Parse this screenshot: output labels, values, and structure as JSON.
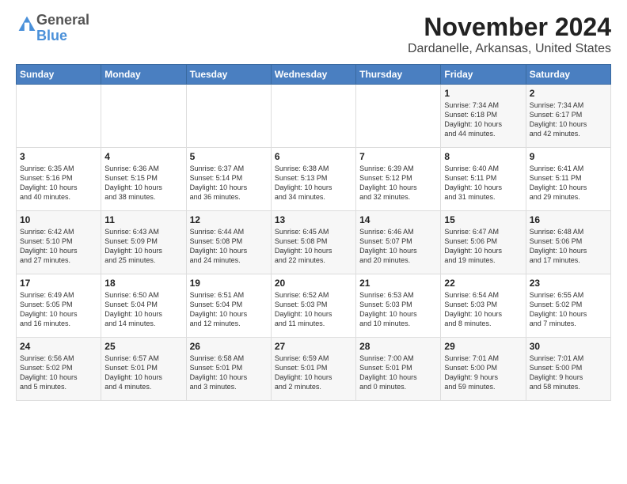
{
  "logo": {
    "general": "General",
    "blue": "Blue"
  },
  "title": "November 2024",
  "location": "Dardanelle, Arkansas, United States",
  "days_header": [
    "Sunday",
    "Monday",
    "Tuesday",
    "Wednesday",
    "Thursday",
    "Friday",
    "Saturday"
  ],
  "weeks": [
    [
      {
        "day": "",
        "info": ""
      },
      {
        "day": "",
        "info": ""
      },
      {
        "day": "",
        "info": ""
      },
      {
        "day": "",
        "info": ""
      },
      {
        "day": "",
        "info": ""
      },
      {
        "day": "1",
        "info": "Sunrise: 7:34 AM\nSunset: 6:18 PM\nDaylight: 10 hours\nand 44 minutes."
      },
      {
        "day": "2",
        "info": "Sunrise: 7:34 AM\nSunset: 6:17 PM\nDaylight: 10 hours\nand 42 minutes."
      }
    ],
    [
      {
        "day": "3",
        "info": "Sunrise: 6:35 AM\nSunset: 5:16 PM\nDaylight: 10 hours\nand 40 minutes."
      },
      {
        "day": "4",
        "info": "Sunrise: 6:36 AM\nSunset: 5:15 PM\nDaylight: 10 hours\nand 38 minutes."
      },
      {
        "day": "5",
        "info": "Sunrise: 6:37 AM\nSunset: 5:14 PM\nDaylight: 10 hours\nand 36 minutes."
      },
      {
        "day": "6",
        "info": "Sunrise: 6:38 AM\nSunset: 5:13 PM\nDaylight: 10 hours\nand 34 minutes."
      },
      {
        "day": "7",
        "info": "Sunrise: 6:39 AM\nSunset: 5:12 PM\nDaylight: 10 hours\nand 32 minutes."
      },
      {
        "day": "8",
        "info": "Sunrise: 6:40 AM\nSunset: 5:11 PM\nDaylight: 10 hours\nand 31 minutes."
      },
      {
        "day": "9",
        "info": "Sunrise: 6:41 AM\nSunset: 5:11 PM\nDaylight: 10 hours\nand 29 minutes."
      }
    ],
    [
      {
        "day": "10",
        "info": "Sunrise: 6:42 AM\nSunset: 5:10 PM\nDaylight: 10 hours\nand 27 minutes."
      },
      {
        "day": "11",
        "info": "Sunrise: 6:43 AM\nSunset: 5:09 PM\nDaylight: 10 hours\nand 25 minutes."
      },
      {
        "day": "12",
        "info": "Sunrise: 6:44 AM\nSunset: 5:08 PM\nDaylight: 10 hours\nand 24 minutes."
      },
      {
        "day": "13",
        "info": "Sunrise: 6:45 AM\nSunset: 5:08 PM\nDaylight: 10 hours\nand 22 minutes."
      },
      {
        "day": "14",
        "info": "Sunrise: 6:46 AM\nSunset: 5:07 PM\nDaylight: 10 hours\nand 20 minutes."
      },
      {
        "day": "15",
        "info": "Sunrise: 6:47 AM\nSunset: 5:06 PM\nDaylight: 10 hours\nand 19 minutes."
      },
      {
        "day": "16",
        "info": "Sunrise: 6:48 AM\nSunset: 5:06 PM\nDaylight: 10 hours\nand 17 minutes."
      }
    ],
    [
      {
        "day": "17",
        "info": "Sunrise: 6:49 AM\nSunset: 5:05 PM\nDaylight: 10 hours\nand 16 minutes."
      },
      {
        "day": "18",
        "info": "Sunrise: 6:50 AM\nSunset: 5:04 PM\nDaylight: 10 hours\nand 14 minutes."
      },
      {
        "day": "19",
        "info": "Sunrise: 6:51 AM\nSunset: 5:04 PM\nDaylight: 10 hours\nand 12 minutes."
      },
      {
        "day": "20",
        "info": "Sunrise: 6:52 AM\nSunset: 5:03 PM\nDaylight: 10 hours\nand 11 minutes."
      },
      {
        "day": "21",
        "info": "Sunrise: 6:53 AM\nSunset: 5:03 PM\nDaylight: 10 hours\nand 10 minutes."
      },
      {
        "day": "22",
        "info": "Sunrise: 6:54 AM\nSunset: 5:03 PM\nDaylight: 10 hours\nand 8 minutes."
      },
      {
        "day": "23",
        "info": "Sunrise: 6:55 AM\nSunset: 5:02 PM\nDaylight: 10 hours\nand 7 minutes."
      }
    ],
    [
      {
        "day": "24",
        "info": "Sunrise: 6:56 AM\nSunset: 5:02 PM\nDaylight: 10 hours\nand 5 minutes."
      },
      {
        "day": "25",
        "info": "Sunrise: 6:57 AM\nSunset: 5:01 PM\nDaylight: 10 hours\nand 4 minutes."
      },
      {
        "day": "26",
        "info": "Sunrise: 6:58 AM\nSunset: 5:01 PM\nDaylight: 10 hours\nand 3 minutes."
      },
      {
        "day": "27",
        "info": "Sunrise: 6:59 AM\nSunset: 5:01 PM\nDaylight: 10 hours\nand 2 minutes."
      },
      {
        "day": "28",
        "info": "Sunrise: 7:00 AM\nSunset: 5:01 PM\nDaylight: 10 hours\nand 0 minutes."
      },
      {
        "day": "29",
        "info": "Sunrise: 7:01 AM\nSunset: 5:00 PM\nDaylight: 9 hours\nand 59 minutes."
      },
      {
        "day": "30",
        "info": "Sunrise: 7:01 AM\nSunset: 5:00 PM\nDaylight: 9 hours\nand 58 minutes."
      }
    ]
  ]
}
